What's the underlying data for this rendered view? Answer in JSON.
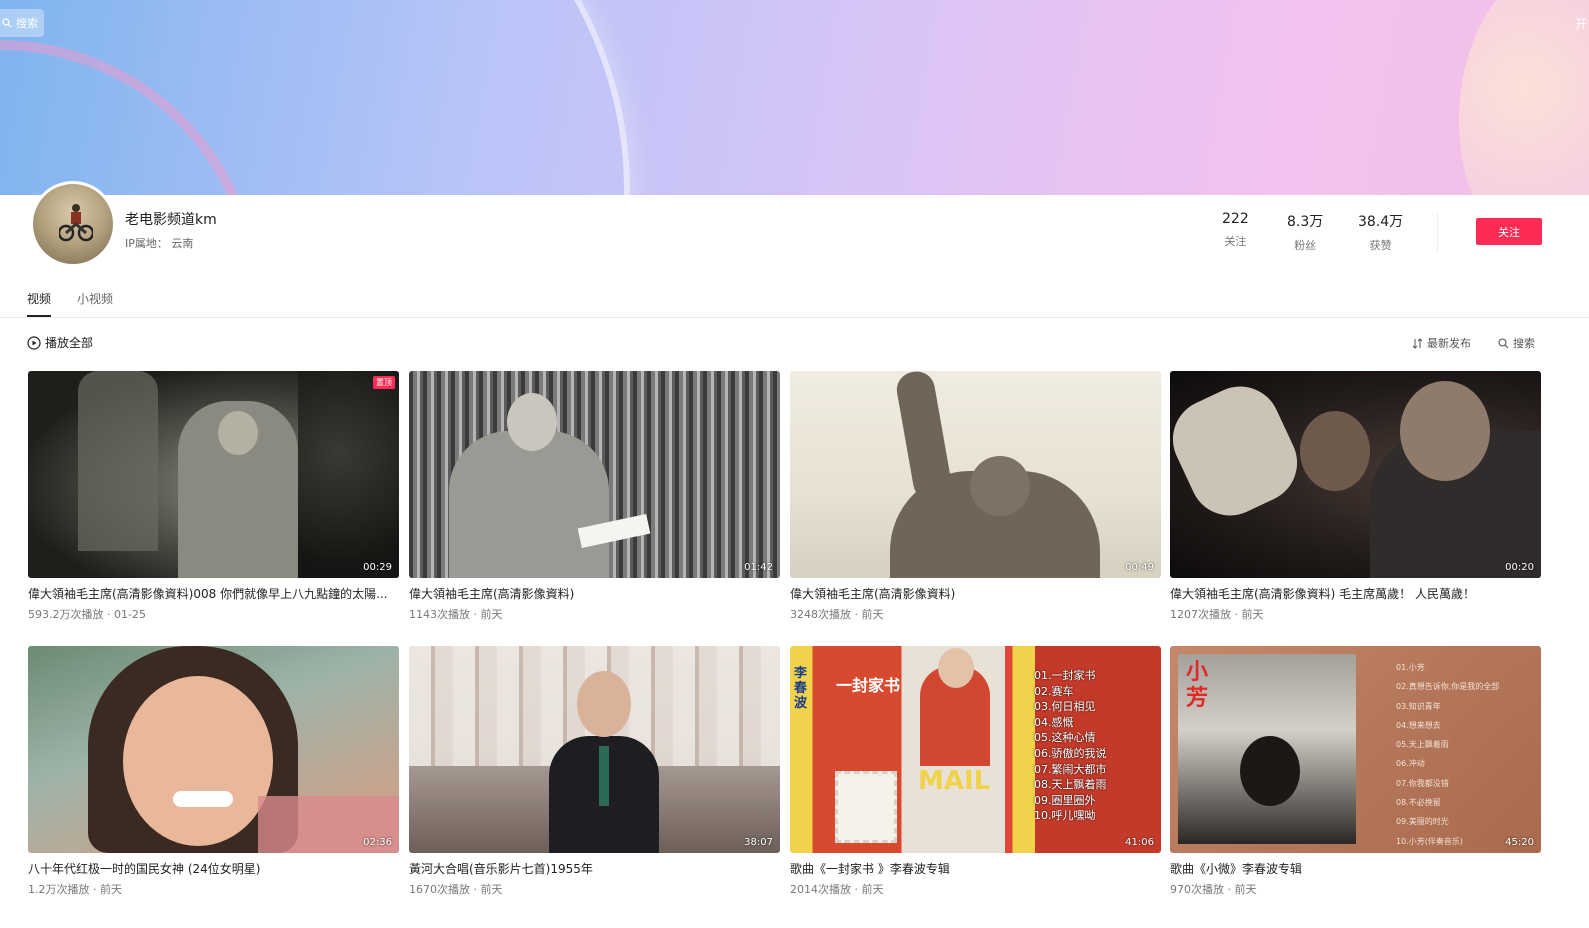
{
  "banner": {
    "search_label": "搜索",
    "right_text": "开"
  },
  "profile": {
    "name": "老电影频道km",
    "ip_label": "IP属地：",
    "ip_value": "云南",
    "stats": [
      {
        "value": "222",
        "label": "关注"
      },
      {
        "value": "8.3万",
        "label": "粉丝"
      },
      {
        "value": "38.4万",
        "label": "获赞"
      }
    ],
    "follow_label": "关注"
  },
  "tabs": [
    {
      "label": "视频",
      "active": true
    },
    {
      "label": "小视频",
      "active": false
    }
  ],
  "toolbar": {
    "play_all": "播放全部",
    "sort": "最新发布",
    "search": "搜索"
  },
  "videos": [
    {
      "title": "偉大領袖毛主席(高清影像資料)008 你們就像早上八九點鐘的太陽...",
      "meta": "593.2万次播放 · 01-25",
      "duration": "00:29",
      "badge": "置顶"
    },
    {
      "title": "偉大領袖毛主席(高清影像資料)",
      "meta": "1143次播放 · 前天",
      "duration": "01:42"
    },
    {
      "title": "偉大領袖毛主席(高清影像資料)",
      "meta": "3248次播放 · 前天",
      "duration": "00:49"
    },
    {
      "title": "偉大領袖毛主席(高清影像資料) 毛主席萬歲！ 人民萬歲！",
      "meta": "1207次播放 · 前天",
      "duration": "00:20"
    },
    {
      "title": "八十年代红极一时的国民女神 (24位女明星)",
      "meta": "1.2万次播放 · 前天",
      "duration": "02:36"
    },
    {
      "title": "黃河大合唱(音乐影片七首)1955年",
      "meta": "1670次播放 · 前天",
      "duration": "38:07"
    },
    {
      "title": "歌曲《一封家书 》李春波专辑",
      "meta": "2014次播放 · 前天",
      "duration": "41:06"
    },
    {
      "title": "歌曲《小微》李春波专辑",
      "meta": "970次播放 · 前天",
      "duration": "45:20"
    }
  ],
  "thumb_text": {
    "t7_list": [
      "01.一封家书",
      "02.赛车",
      "03.何日相见",
      "04.感慨",
      "05.这种心情",
      "06.骄傲的我说",
      "07.繁闹大都市",
      "08.天上飘着雨",
      "09.圈里圈外",
      "10.呼儿嘿呦"
    ],
    "t7_artist": "李春波",
    "t7_album": "一封家书",
    "t7_mail": "MAIL",
    "t8_title": "小芳",
    "t8_list": [
      "01.小芳",
      "02.真想告诉你,你是我的全部",
      "03.知识青年",
      "04.想来想去",
      "05.天上飘着雨",
      "06.冲动",
      "07.你我都没错",
      "08.不必挽留",
      "09.美丽的时光",
      "10.小芳(伴奏音乐)"
    ]
  }
}
